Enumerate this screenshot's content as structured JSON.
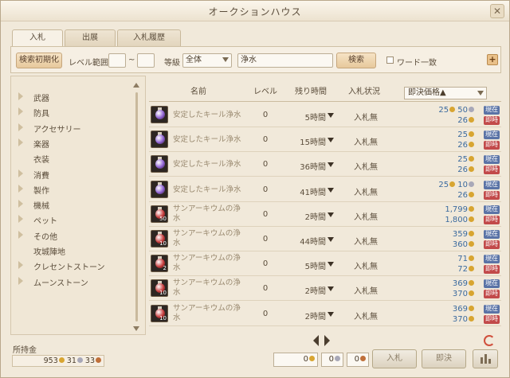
{
  "window": {
    "title": "オークションハウス",
    "close_label": "✕"
  },
  "tabs": [
    {
      "label": "入札",
      "active": true
    },
    {
      "label": "出展",
      "active": false
    },
    {
      "label": "入札履歴",
      "active": false
    }
  ],
  "toolbar": {
    "reset_label": "検索初期化",
    "level_range_label": "レベル範囲",
    "level_min": "",
    "level_max": "",
    "level_sep": "~",
    "grade_label": "等級",
    "grade_value": "全体",
    "search_value": "浄水",
    "search_button": "検索",
    "exact_match_label": "ワード一致",
    "plus_label": "+"
  },
  "categories": [
    {
      "label": "武器",
      "expandable": true
    },
    {
      "label": "防具",
      "expandable": true
    },
    {
      "label": "アクセサリー",
      "expandable": true
    },
    {
      "label": "楽器",
      "expandable": true
    },
    {
      "label": "衣装",
      "expandable": false
    },
    {
      "label": "消費",
      "expandable": true
    },
    {
      "label": "製作",
      "expandable": true
    },
    {
      "label": "機械",
      "expandable": true
    },
    {
      "label": "ペット",
      "expandable": true
    },
    {
      "label": "その他",
      "expandable": true
    },
    {
      "label": "攻城陣地",
      "expandable": false
    },
    {
      "label": "クレセントストーン",
      "expandable": true
    },
    {
      "label": "ムーンストーン",
      "expandable": true
    }
  ],
  "table": {
    "headers": {
      "name": "名前",
      "level": "レベル",
      "time": "残り時間",
      "status": "入札状況",
      "sort": "即決価格▲"
    },
    "rows": [
      {
        "name": "安定したキール浄水",
        "level": "0",
        "time": "5時間",
        "status": "入札無",
        "current_main": "25",
        "current_sub": "50",
        "buyout_main": "26",
        "buyout_sub": "",
        "count": "",
        "potion": "purple"
      },
      {
        "name": "安定したキール浄水",
        "level": "0",
        "time": "15時間",
        "status": "入札無",
        "current_main": "25",
        "current_sub": "",
        "buyout_main": "26",
        "buyout_sub": "",
        "count": "",
        "potion": "purple"
      },
      {
        "name": "安定したキール浄水",
        "level": "0",
        "time": "36時間",
        "status": "入札無",
        "current_main": "25",
        "current_sub": "",
        "buyout_main": "26",
        "buyout_sub": "",
        "count": "",
        "potion": "purple"
      },
      {
        "name": "安定したキール浄水",
        "level": "0",
        "time": "41時間",
        "status": "入札無",
        "current_main": "25",
        "current_sub": "10",
        "buyout_main": "26",
        "buyout_sub": "",
        "count": "",
        "potion": "purple"
      },
      {
        "name": "サンアーキウムの浄水",
        "level": "0",
        "time": "2時間",
        "status": "入札無",
        "current_main": "1,799",
        "current_sub": "",
        "buyout_main": "1,800",
        "buyout_sub": "",
        "count": "50",
        "potion": "red"
      },
      {
        "name": "サンアーキウムの浄水",
        "level": "0",
        "time": "44時間",
        "status": "入札無",
        "current_main": "359",
        "current_sub": "",
        "buyout_main": "360",
        "buyout_sub": "",
        "count": "10",
        "potion": "red"
      },
      {
        "name": "サンアーキウムの浄水",
        "level": "0",
        "time": "5時間",
        "status": "入札無",
        "current_main": "71",
        "current_sub": "",
        "buyout_main": "72",
        "buyout_sub": "",
        "count": "2",
        "potion": "red"
      },
      {
        "name": "サンアーキウムの浄水",
        "level": "0",
        "time": "2時間",
        "status": "入札無",
        "current_main": "369",
        "current_sub": "",
        "buyout_main": "370",
        "buyout_sub": "",
        "count": "10",
        "potion": "red"
      },
      {
        "name": "サンアーキウムの浄水",
        "level": "0",
        "time": "2時間",
        "status": "入札無",
        "current_main": "369",
        "current_sub": "",
        "buyout_main": "370",
        "buyout_sub": "",
        "count": "10",
        "potion": "red"
      }
    ],
    "tag_now": "現在",
    "tag_buyout": "即時"
  },
  "bottom": {
    "gold_label": "所持金",
    "gold_value": "953",
    "silver_value": "31",
    "copper_value": "33",
    "bid_gold": "0",
    "bid_silver": "0",
    "bid_copper": "0",
    "bid_button": "入札",
    "buyout_button": "即決"
  },
  "colors": {
    "gold": "#d8a531",
    "silver": "#a8a8b8",
    "copper": "#c0703a",
    "purple_potion": "#8d5fd1",
    "red_potion": "#c63b3b"
  }
}
